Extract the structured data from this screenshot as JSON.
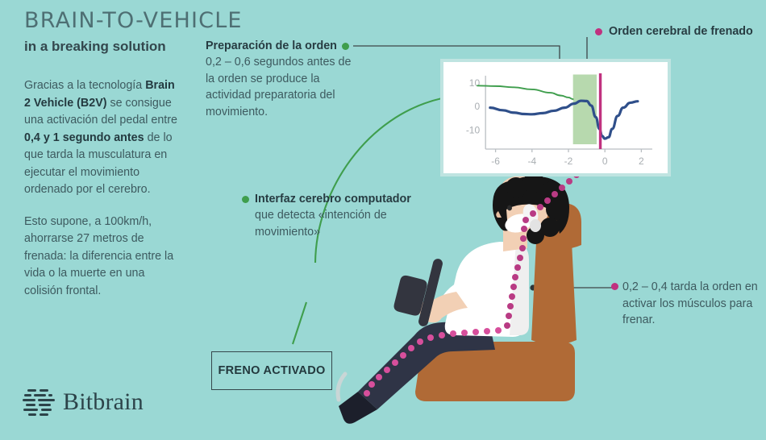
{
  "colors": {
    "background": "#9ad8d4",
    "panel": "#ffffff",
    "panel_border": "#bfe4e1",
    "accent_green": "#3f9e4d",
    "accent_magenta": "#c0317f",
    "curve_blue": "#2f4f8a",
    "shade_green": "#b7d9ae",
    "text_dark": "#273c42",
    "text_body": "#3d5a5f",
    "title": "#4e6f73",
    "seat_brown": "#b06a36",
    "skin": "#f2d0b5",
    "shirt": "#ffffff",
    "pants": "#2f3446",
    "hair": "#161616"
  },
  "header": {
    "title": "BRAIN-TO-VEHICLE",
    "subtitle": "in a breaking solution"
  },
  "left_copy": {
    "paragraph_1": {
      "part_1": "Gracias a la tecnología ",
      "bold_1": "Brain 2 Vehicle (B2V)",
      "part_2": " se consigue una activación del pedal entre ",
      "bold_2": "0,4 y 1 segundo antes",
      "part_3": " de lo que tarda la musculatura en ejecutar el movimiento ordenado por el cerebro."
    },
    "paragraph_2": "Esto supone, a 100km/h, ahorrarse 27 metros de frenada: la diferencia entre la vida o la muerte en una colisión frontal."
  },
  "annotations": {
    "preparation": {
      "heading": "Preparación de la orden",
      "body": "0,2 – 0,6 segundos antes de la orden se produce la actividad preparatoria del movimiento.",
      "marker": "green-dot-marker"
    },
    "brain_order": {
      "heading": "Orden cerebral de frenado",
      "marker": "magenta-dot-marker"
    },
    "bci": {
      "heading": "Interfaz cerebro computador",
      "body": "que detecta «intención de movimiento»",
      "marker": "green-dot-marker"
    },
    "muscle": {
      "body": "0,2 – 0,4 tarda la orden en activar los músculos para frenar.",
      "marker": "magenta-dot-marker"
    }
  },
  "brake_box": {
    "label": "FRENO ACTIVADO"
  },
  "logo": {
    "text": "Bitbrain",
    "mark": "bitbrain-bars-icon"
  },
  "chart_data": {
    "type": "line",
    "title": "",
    "xlabel": "",
    "ylabel": "",
    "xlim": [
      -7,
      3
    ],
    "ylim": [
      -18,
      14
    ],
    "xticks": [
      -6,
      -4,
      -2,
      0,
      2
    ],
    "yticks": [
      10,
      0,
      -10
    ],
    "xtick_labels": [
      "-6",
      "-4",
      "-2",
      "0",
      "2"
    ],
    "ytick_labels": [
      "10",
      "0",
      "-10"
    ],
    "grid": false,
    "legend": "none",
    "series": [
      {
        "name": "readiness-potential",
        "color": "#2f4f8a",
        "x": [
          -6.3,
          -5.6,
          -5.0,
          -4.4,
          -4.0,
          -3.4,
          -2.8,
          -2.2,
          -1.7,
          -1.3,
          -1.0,
          -0.75,
          -0.5,
          -0.3,
          -0.15,
          0.0,
          0.2,
          0.4,
          0.7,
          1.0,
          1.4,
          1.8
        ],
        "y": [
          -0.5,
          -1.6,
          -2.6,
          -3.2,
          -3.3,
          -2.8,
          -1.8,
          -0.5,
          1.2,
          2.4,
          2.3,
          0.4,
          -4.5,
          -9.5,
          -12.5,
          -13.6,
          -13.0,
          -9.5,
          -4.0,
          -0.5,
          1.6,
          2.2
        ]
      },
      {
        "name": "bci-detection-curve",
        "color": "#3f9e4d",
        "x": [
          -7.0,
          -6.0,
          -5.0,
          -4.0,
          -3.0,
          -2.4,
          -2.0,
          -1.75
        ],
        "y": [
          8.8,
          8.6,
          8.1,
          7.2,
          5.8,
          4.6,
          3.8,
          3.1
        ]
      }
    ],
    "shaded_region": {
      "name": "preparation-window",
      "x_start": -1.75,
      "x_end": -0.45,
      "color": "#b7d9ae",
      "label": "preparación de la orden"
    },
    "vertical_marker": {
      "name": "brain-order-marker",
      "x": -0.25,
      "color": "#c0317f"
    },
    "callout_points": [
      {
        "name": "preparation-callout-point",
        "x": -1.65,
        "y": 12.0
      },
      {
        "name": "brain-order-callout-point",
        "x": -0.25,
        "y": 16.5
      }
    ]
  }
}
